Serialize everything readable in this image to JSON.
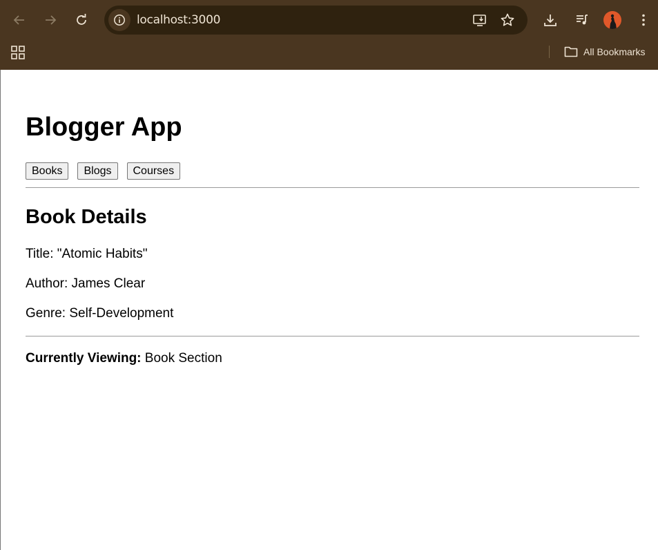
{
  "browser": {
    "url": "localhost:3000",
    "bookmarks_label": "All Bookmarks"
  },
  "app": {
    "title": "Blogger App",
    "nav_buttons": [
      "Books",
      "Blogs",
      "Courses"
    ]
  },
  "details": {
    "heading": "Book Details",
    "title_line": "Title: \"Atomic Habits\"",
    "author_line": "Author: James Clear",
    "genre_line": "Genre: Self-Development"
  },
  "status": {
    "label": "Currently Viewing:",
    "value": "Book Section"
  },
  "colors": {
    "chrome_bg": "#4a3620",
    "omnibox_bg": "#2f220f",
    "avatar_bg": "#e0582a"
  }
}
